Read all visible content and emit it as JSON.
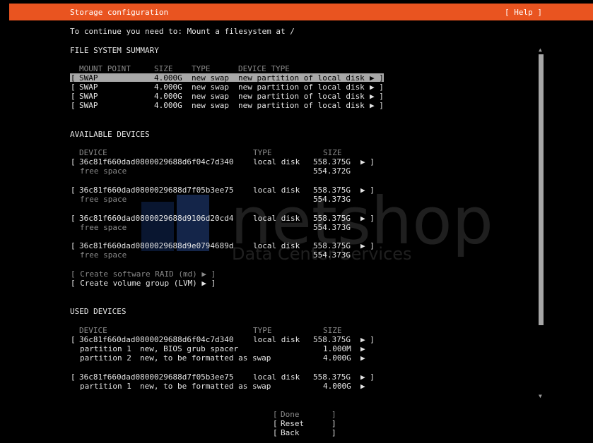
{
  "header": {
    "title": "Storage configuration",
    "help": "[ Help ]"
  },
  "instruction": "To continue you need to: Mount a filesystem at /",
  "watermark": {
    "brand": "netshop",
    "tagline": "Data Center Services"
  },
  "fs_summary": {
    "heading": "FILE SYSTEM SUMMARY",
    "columns": [
      "MOUNT POINT",
      "SIZE",
      "TYPE",
      "DEVICE TYPE"
    ],
    "rows": [
      {
        "mount": "SWAP",
        "size": "4.000G",
        "type": "new swap",
        "device_type": "new partition of local disk",
        "selected": true
      },
      {
        "mount": "SWAP",
        "size": "4.000G",
        "type": "new swap",
        "device_type": "new partition of local disk"
      },
      {
        "mount": "SWAP",
        "size": "4.000G",
        "type": "new swap",
        "device_type": "new partition of local disk"
      },
      {
        "mount": "SWAP",
        "size": "4.000G",
        "type": "new swap",
        "device_type": "new partition of local disk"
      }
    ]
  },
  "available": {
    "heading": "AVAILABLE DEVICES",
    "columns": [
      "DEVICE",
      "TYPE",
      "SIZE"
    ],
    "devices": [
      {
        "name": "36c81f660dad0800029688d6f04c7d340",
        "type": "local disk",
        "size": "558.375G",
        "free_label": "free space",
        "free_size": "554.372G"
      },
      {
        "name": "36c81f660dad0800029688d7f05b3ee75",
        "type": "local disk",
        "size": "558.375G",
        "free_label": "free space",
        "free_size": "554.373G"
      },
      {
        "name": "36c81f660dad0800029688d9106d20cd4",
        "type": "local disk",
        "size": "558.375G",
        "free_label": "free space",
        "free_size": "554.373G"
      },
      {
        "name": "36c81f660dad0800029688d9e0794689d",
        "type": "local disk",
        "size": "558.375G",
        "free_label": "free space",
        "free_size": "554.373G"
      }
    ],
    "create_raid": "[ Create software RAID (md) ▶ ]",
    "create_lvm": "[ Create volume group (LVM) ▶ ]"
  },
  "used": {
    "heading": "USED DEVICES",
    "columns": [
      "DEVICE",
      "TYPE",
      "SIZE"
    ],
    "devices": [
      {
        "name": "36c81f660dad0800029688d6f04c7d340",
        "type": "local disk",
        "size": "558.375G",
        "partitions": [
          {
            "label": "partition 1",
            "desc": "new, BIOS grub spacer",
            "size": "1.000M"
          },
          {
            "label": "partition 2",
            "desc": "new, to be formatted as swap",
            "size": "4.000G"
          }
        ]
      },
      {
        "name": "36c81f660dad0800029688d7f05b3ee75",
        "type": "local disk",
        "size": "558.375G",
        "partitions": [
          {
            "label": "partition 1",
            "desc": "new, to be formatted as swap",
            "size": "4.000G"
          }
        ]
      }
    ]
  },
  "buttons": {
    "done": "Done",
    "reset": "Reset",
    "back": "Back"
  }
}
